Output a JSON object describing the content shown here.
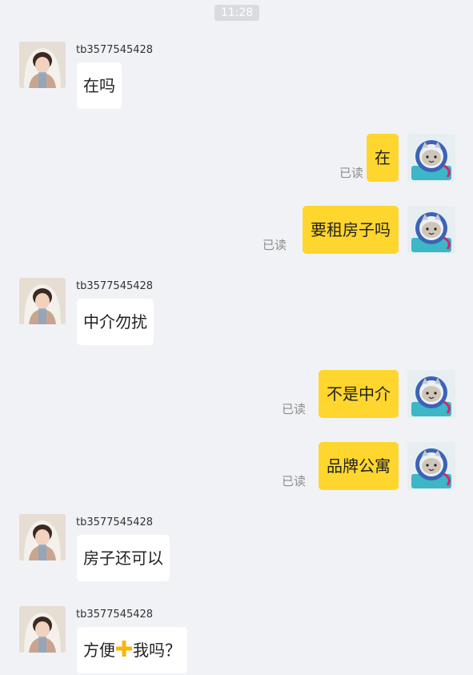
{
  "status": {
    "time": "11:28"
  },
  "messages": [
    {
      "direction": "in",
      "sender": "tb3577545428",
      "text": "在吗"
    },
    {
      "direction": "out",
      "read": "已读",
      "text": "在"
    },
    {
      "direction": "out",
      "read": "已读",
      "text": "要租房子吗"
    },
    {
      "direction": "in",
      "sender": "tb3577545428",
      "text": "中介勿扰"
    },
    {
      "direction": "out",
      "read": "已读",
      "text": "不是中介"
    },
    {
      "direction": "out",
      "read": "已读",
      "text": "品牌公寓"
    },
    {
      "direction": "in",
      "sender": "tb3577545428",
      "text": "房子还可以"
    },
    {
      "direction": "in",
      "sender": "tb3577545428",
      "text_before": "方便",
      "icon": "plus-icon",
      "text_after": "我吗？"
    }
  ],
  "colors": {
    "background": "#f1f2f6",
    "outgoing_bubble": "#fed62e",
    "incoming_bubble": "#ffffff",
    "plus_icon": "#f6b60c"
  }
}
